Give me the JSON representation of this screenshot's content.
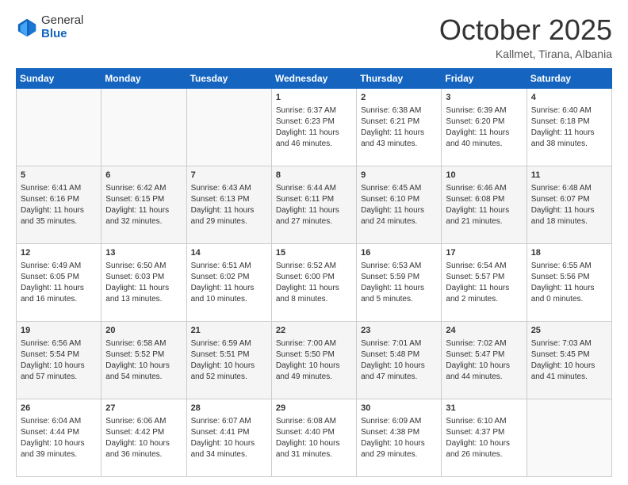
{
  "header": {
    "logo_general": "General",
    "logo_blue": "Blue",
    "month": "October 2025",
    "location": "Kallmet, Tirana, Albania"
  },
  "weekdays": [
    "Sunday",
    "Monday",
    "Tuesday",
    "Wednesday",
    "Thursday",
    "Friday",
    "Saturday"
  ],
  "weeks": [
    [
      {
        "day": "",
        "sunrise": "",
        "sunset": "",
        "daylight": ""
      },
      {
        "day": "",
        "sunrise": "",
        "sunset": "",
        "daylight": ""
      },
      {
        "day": "",
        "sunrise": "",
        "sunset": "",
        "daylight": ""
      },
      {
        "day": "1",
        "sunrise": "Sunrise: 6:37 AM",
        "sunset": "Sunset: 6:23 PM",
        "daylight": "Daylight: 11 hours and 46 minutes."
      },
      {
        "day": "2",
        "sunrise": "Sunrise: 6:38 AM",
        "sunset": "Sunset: 6:21 PM",
        "daylight": "Daylight: 11 hours and 43 minutes."
      },
      {
        "day": "3",
        "sunrise": "Sunrise: 6:39 AM",
        "sunset": "Sunset: 6:20 PM",
        "daylight": "Daylight: 11 hours and 40 minutes."
      },
      {
        "day": "4",
        "sunrise": "Sunrise: 6:40 AM",
        "sunset": "Sunset: 6:18 PM",
        "daylight": "Daylight: 11 hours and 38 minutes."
      }
    ],
    [
      {
        "day": "5",
        "sunrise": "Sunrise: 6:41 AM",
        "sunset": "Sunset: 6:16 PM",
        "daylight": "Daylight: 11 hours and 35 minutes."
      },
      {
        "day": "6",
        "sunrise": "Sunrise: 6:42 AM",
        "sunset": "Sunset: 6:15 PM",
        "daylight": "Daylight: 11 hours and 32 minutes."
      },
      {
        "day": "7",
        "sunrise": "Sunrise: 6:43 AM",
        "sunset": "Sunset: 6:13 PM",
        "daylight": "Daylight: 11 hours and 29 minutes."
      },
      {
        "day": "8",
        "sunrise": "Sunrise: 6:44 AM",
        "sunset": "Sunset: 6:11 PM",
        "daylight": "Daylight: 11 hours and 27 minutes."
      },
      {
        "day": "9",
        "sunrise": "Sunrise: 6:45 AM",
        "sunset": "Sunset: 6:10 PM",
        "daylight": "Daylight: 11 hours and 24 minutes."
      },
      {
        "day": "10",
        "sunrise": "Sunrise: 6:46 AM",
        "sunset": "Sunset: 6:08 PM",
        "daylight": "Daylight: 11 hours and 21 minutes."
      },
      {
        "day": "11",
        "sunrise": "Sunrise: 6:48 AM",
        "sunset": "Sunset: 6:07 PM",
        "daylight": "Daylight: 11 hours and 18 minutes."
      }
    ],
    [
      {
        "day": "12",
        "sunrise": "Sunrise: 6:49 AM",
        "sunset": "Sunset: 6:05 PM",
        "daylight": "Daylight: 11 hours and 16 minutes."
      },
      {
        "day": "13",
        "sunrise": "Sunrise: 6:50 AM",
        "sunset": "Sunset: 6:03 PM",
        "daylight": "Daylight: 11 hours and 13 minutes."
      },
      {
        "day": "14",
        "sunrise": "Sunrise: 6:51 AM",
        "sunset": "Sunset: 6:02 PM",
        "daylight": "Daylight: 11 hours and 10 minutes."
      },
      {
        "day": "15",
        "sunrise": "Sunrise: 6:52 AM",
        "sunset": "Sunset: 6:00 PM",
        "daylight": "Daylight: 11 hours and 8 minutes."
      },
      {
        "day": "16",
        "sunrise": "Sunrise: 6:53 AM",
        "sunset": "Sunset: 5:59 PM",
        "daylight": "Daylight: 11 hours and 5 minutes."
      },
      {
        "day": "17",
        "sunrise": "Sunrise: 6:54 AM",
        "sunset": "Sunset: 5:57 PM",
        "daylight": "Daylight: 11 hours and 2 minutes."
      },
      {
        "day": "18",
        "sunrise": "Sunrise: 6:55 AM",
        "sunset": "Sunset: 5:56 PM",
        "daylight": "Daylight: 11 hours and 0 minutes."
      }
    ],
    [
      {
        "day": "19",
        "sunrise": "Sunrise: 6:56 AM",
        "sunset": "Sunset: 5:54 PM",
        "daylight": "Daylight: 10 hours and 57 minutes."
      },
      {
        "day": "20",
        "sunrise": "Sunrise: 6:58 AM",
        "sunset": "Sunset: 5:52 PM",
        "daylight": "Daylight: 10 hours and 54 minutes."
      },
      {
        "day": "21",
        "sunrise": "Sunrise: 6:59 AM",
        "sunset": "Sunset: 5:51 PM",
        "daylight": "Daylight: 10 hours and 52 minutes."
      },
      {
        "day": "22",
        "sunrise": "Sunrise: 7:00 AM",
        "sunset": "Sunset: 5:50 PM",
        "daylight": "Daylight: 10 hours and 49 minutes."
      },
      {
        "day": "23",
        "sunrise": "Sunrise: 7:01 AM",
        "sunset": "Sunset: 5:48 PM",
        "daylight": "Daylight: 10 hours and 47 minutes."
      },
      {
        "day": "24",
        "sunrise": "Sunrise: 7:02 AM",
        "sunset": "Sunset: 5:47 PM",
        "daylight": "Daylight: 10 hours and 44 minutes."
      },
      {
        "day": "25",
        "sunrise": "Sunrise: 7:03 AM",
        "sunset": "Sunset: 5:45 PM",
        "daylight": "Daylight: 10 hours and 41 minutes."
      }
    ],
    [
      {
        "day": "26",
        "sunrise": "Sunrise: 6:04 AM",
        "sunset": "Sunset: 4:44 PM",
        "daylight": "Daylight: 10 hours and 39 minutes."
      },
      {
        "day": "27",
        "sunrise": "Sunrise: 6:06 AM",
        "sunset": "Sunset: 4:42 PM",
        "daylight": "Daylight: 10 hours and 36 minutes."
      },
      {
        "day": "28",
        "sunrise": "Sunrise: 6:07 AM",
        "sunset": "Sunset: 4:41 PM",
        "daylight": "Daylight: 10 hours and 34 minutes."
      },
      {
        "day": "29",
        "sunrise": "Sunrise: 6:08 AM",
        "sunset": "Sunset: 4:40 PM",
        "daylight": "Daylight: 10 hours and 31 minutes."
      },
      {
        "day": "30",
        "sunrise": "Sunrise: 6:09 AM",
        "sunset": "Sunset: 4:38 PM",
        "daylight": "Daylight: 10 hours and 29 minutes."
      },
      {
        "day": "31",
        "sunrise": "Sunrise: 6:10 AM",
        "sunset": "Sunset: 4:37 PM",
        "daylight": "Daylight: 10 hours and 26 minutes."
      },
      {
        "day": "",
        "sunrise": "",
        "sunset": "",
        "daylight": ""
      }
    ]
  ]
}
